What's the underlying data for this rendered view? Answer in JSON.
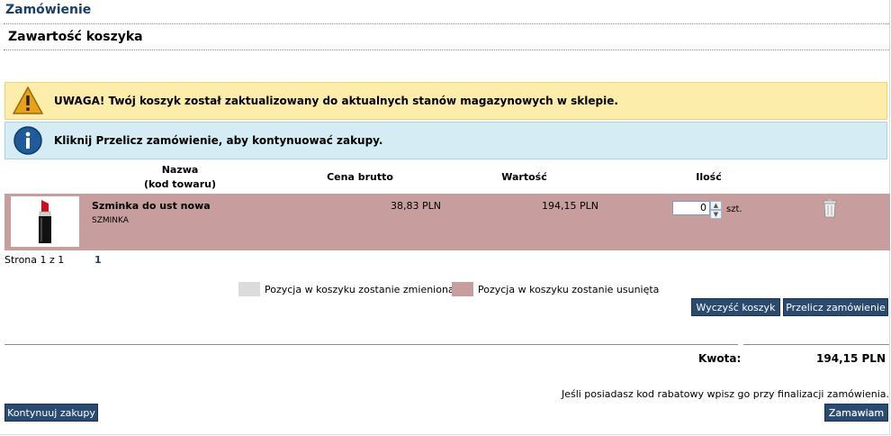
{
  "header": {
    "page_title": "Zamówienie",
    "section_title": "Zawartość koszyka"
  },
  "alerts": {
    "warning": {
      "icon": "warning-icon",
      "text": "UWAGA! Twój koszyk został zaktualizowany do aktualnych stanów magazynowych w sklepie."
    },
    "info": {
      "icon": "info-icon",
      "text": "Kliknij Przelicz zamówienie, aby kontynuować zakupy."
    }
  },
  "table": {
    "headers": {
      "name_line1": "Nazwa",
      "name_line2": "(kod towaru)",
      "price": "Cena brutto",
      "value": "Wartość",
      "qty": "Ilość"
    },
    "rows": [
      {
        "name": "Szminka do ust nowa",
        "code": "SZMINKA",
        "price": "38,83 PLN",
        "value": "194,15 PLN",
        "qty": "0",
        "unit": "szt.",
        "row_color": "#c79e9d"
      }
    ]
  },
  "pager": {
    "label": "Strona 1 z 1",
    "current": "1"
  },
  "legend": {
    "changed": {
      "label": "Pozycja w koszyku zostanie zmieniona",
      "color": "#dcdcdc"
    },
    "removed": {
      "label": "Pozycja w koszyku zostanie usunięta",
      "color": "#c79e9d"
    }
  },
  "buttons": {
    "clear": "Wyczyść koszyk",
    "recalc": "Przelicz zamówienie",
    "continue": "Kontynuuj zakupy",
    "order": "Zamawiam"
  },
  "summary": {
    "label": "Kwota:",
    "value": "194,15 PLN"
  },
  "discount_note": "Jeśli posiadasz kod rabatowy wpisz go przy finalizacji zamówienia.",
  "colors": {
    "accent": "#2b4a6f",
    "title": "#1a3f6b"
  }
}
